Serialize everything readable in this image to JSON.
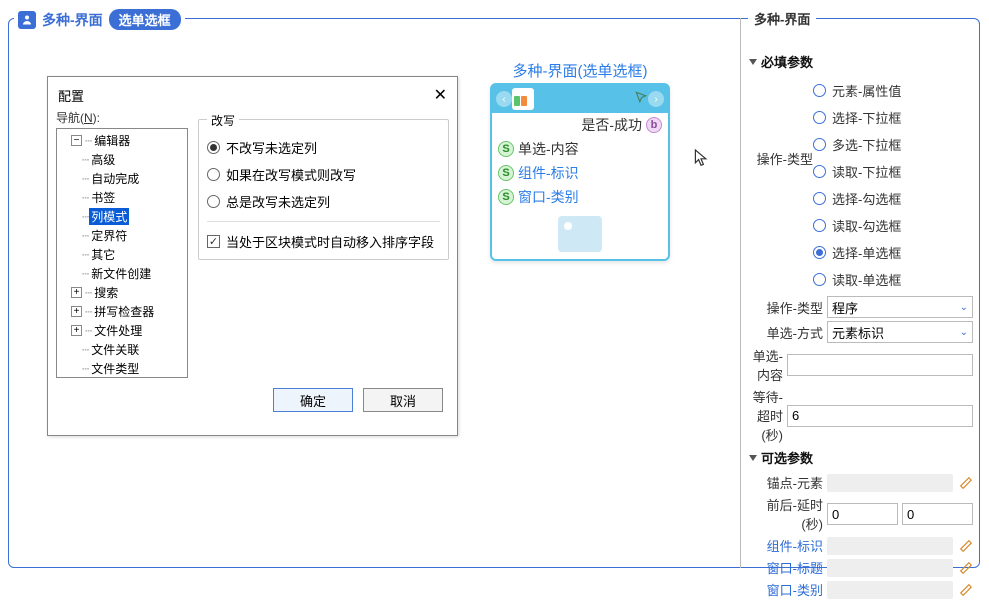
{
  "header": {
    "title": "多种-界面",
    "pill": "选单选框"
  },
  "right": {
    "title": "多种-界面",
    "section_required": "必填参数",
    "section_optional": "可选参数",
    "radio_group_label": "操作-类型",
    "radios": [
      "元素-属性值",
      "选择-下拉框",
      "多选-下拉框",
      "读取-下拉框",
      "选择-勾选框",
      "读取-勾选框",
      "选择-单选框",
      "读取-单选框"
    ],
    "radio_selected_index": 6,
    "form": {
      "op_type_label": "操作-类型",
      "op_type_value": "程序",
      "select_mode_label": "单选-方式",
      "select_mode_value": "元素标识",
      "select_content_label": "单选-内容",
      "select_content_value": "",
      "timeout_label": "等待-超时(秒)",
      "timeout_value": "6",
      "anchor_label": "锚点-元素",
      "delay_label": "前后-延时(秒)",
      "delay_before": "0",
      "delay_after": "0",
      "comp_id_label": "组件-标识",
      "win_title_label": "窗口-标题",
      "win_class_label": "窗口-类别"
    }
  },
  "node": {
    "title": "多种-界面(选单选框)",
    "row_success": "是否-成功",
    "row_content": "单选-内容",
    "row_comp": "组件-标识",
    "row_class": "窗口-类别"
  },
  "dialog": {
    "title": "配置",
    "nav_label_prefix": "导航(",
    "nav_label_key": "N",
    "nav_label_suffix": "):",
    "tree": {
      "editor": "编辑器",
      "advanced": "高级",
      "autocomplete": "自动完成",
      "bookmark": "书签",
      "colmode": "列模式",
      "delim": "定界符",
      "other": "其它",
      "newfile": "新文件创建",
      "search": "搜索",
      "spell": "拼写检查器",
      "filehandle": "文件处理",
      "fileassoc": "文件关联",
      "filetype": "文件类型"
    },
    "group": {
      "legend": "改写",
      "r1": "不改写未选定列",
      "r2": "如果在改写模式则改写",
      "r3": "总是改写未选定列",
      "check": "当处于区块模式时自动移入排序字段"
    },
    "ok": "确定",
    "cancel": "取消"
  }
}
